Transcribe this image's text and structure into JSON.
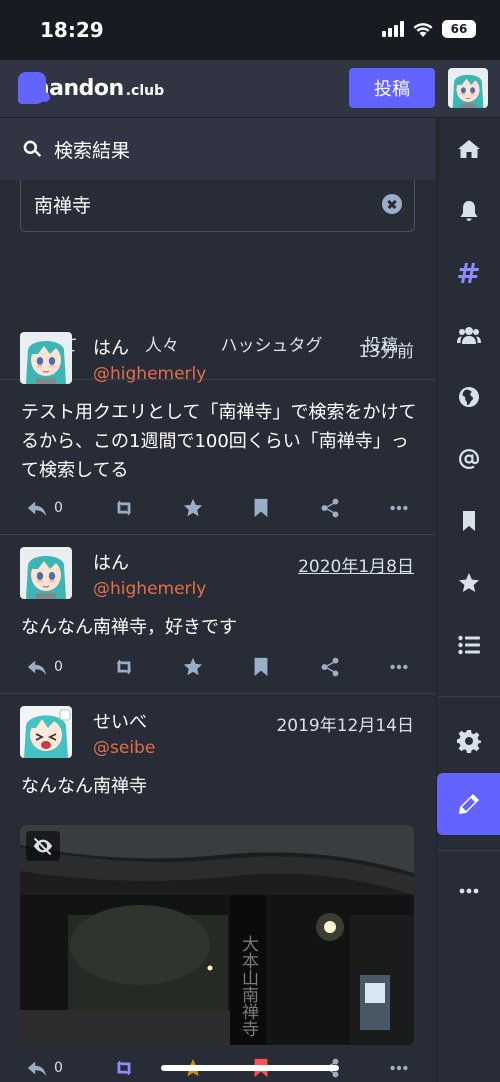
{
  "status_bar": {
    "time": "18:29",
    "battery": "66"
  },
  "app": {
    "logo_text": "handon",
    "logo_tld": ".club",
    "post_button": "投稿"
  },
  "column": {
    "title": "検索結果"
  },
  "search": {
    "value": "南禅寺"
  },
  "tabs": [
    {
      "label": "すべて"
    },
    {
      "label": "人々"
    },
    {
      "label": "ハッシュタグ"
    },
    {
      "label": "投稿"
    }
  ],
  "statuses": [
    {
      "display_name": "はん",
      "account": "@highemerly",
      "time": "13分前",
      "content": "テスト用クエリとして「南禅寺」で検索をかけてるから、この1週間で100回くらい「南禅寺」って検索してる",
      "reply_count": "0"
    },
    {
      "display_name": "はん",
      "account": "@highemerly",
      "time": "2020年1月8日",
      "content": "なんなん南禅寺，好きです",
      "reply_count": "0"
    },
    {
      "display_name": "せいべ",
      "account": "@seibe",
      "time": "2019年12月14日",
      "content": "なんなん南禅寺",
      "reply_count": "0",
      "media_sign": "大本山南禅寺"
    }
  ],
  "nav_icons": [
    "home-icon",
    "bell-icon",
    "hashtag-icon",
    "users-icon",
    "globe-icon",
    "at-icon",
    "bookmark-icon",
    "star-icon",
    "list-icon",
    "gear-icon",
    "pencil-icon",
    "ellipsis-icon"
  ],
  "colors": {
    "accent": "#6364ff",
    "account": "#e2704a",
    "background": "#282c37"
  }
}
